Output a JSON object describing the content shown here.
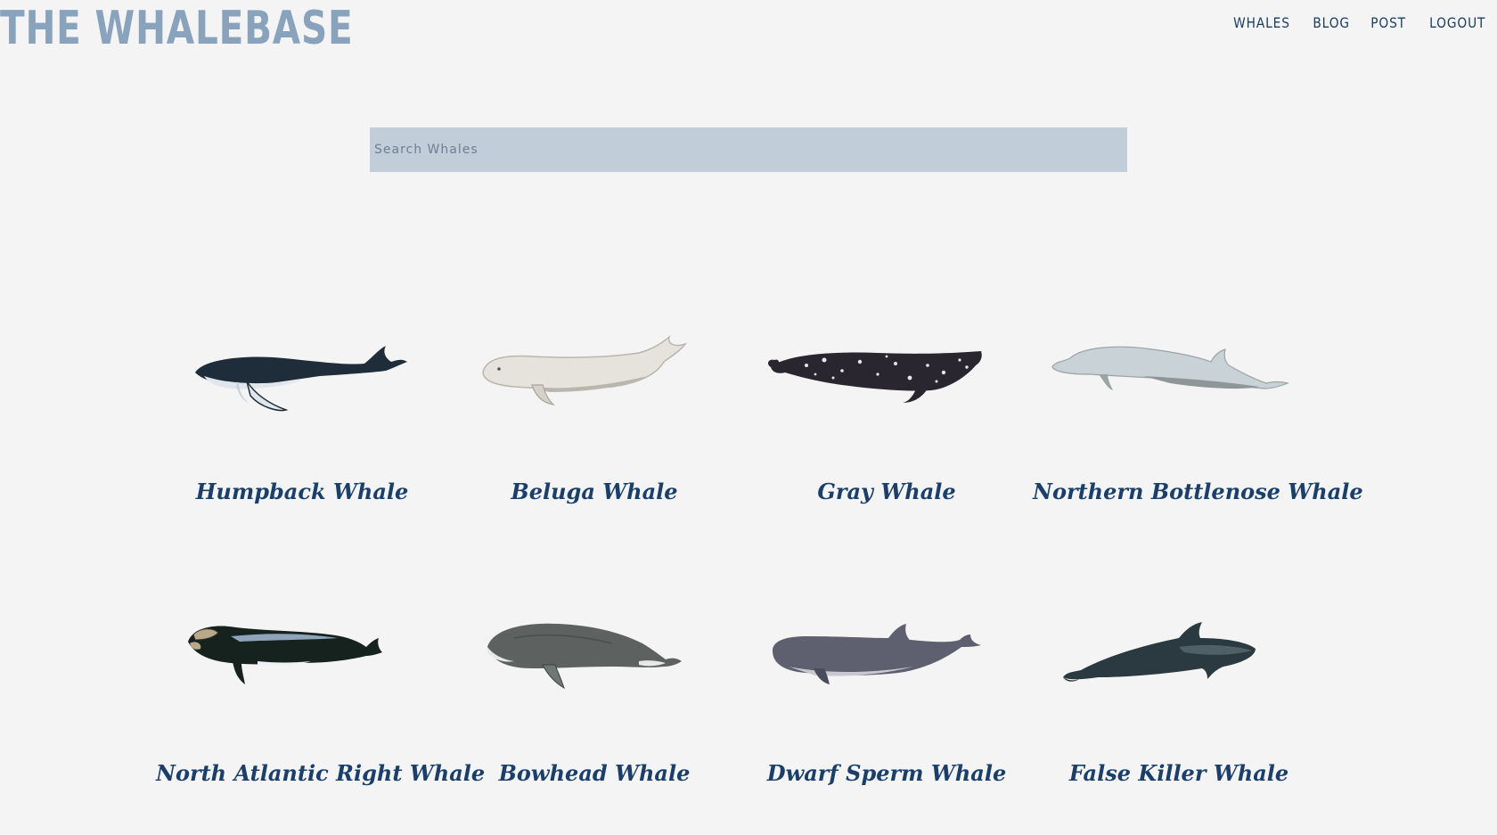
{
  "header": {
    "brand": "THE WHALEBASE",
    "nav": [
      "WHALES",
      "BLOG",
      "POST",
      "LOGOUT"
    ]
  },
  "search": {
    "placeholder": "Search Whales",
    "value": ""
  },
  "whales": [
    {
      "name": "Humpback Whale",
      "icon": "humpback-whale-icon"
    },
    {
      "name": "Beluga Whale",
      "icon": "beluga-whale-icon"
    },
    {
      "name": "Gray Whale",
      "icon": "gray-whale-icon"
    },
    {
      "name": "Northern Bottlenose Whale",
      "icon": "bottlenose-whale-icon"
    },
    {
      "name": "North Atlantic Right Whale",
      "icon": "right-whale-icon"
    },
    {
      "name": "Bowhead Whale",
      "icon": "bowhead-whale-icon"
    },
    {
      "name": "Dwarf Sperm Whale",
      "icon": "dwarf-sperm-whale-icon"
    },
    {
      "name": "False Killer Whale",
      "icon": "false-killer-whale-icon"
    }
  ],
  "colors": {
    "background": "#f4f4f4",
    "brand": "#8aa3bd",
    "nav": "#1b3d63",
    "search_bg": "#c1cdd9",
    "card_title": "#1b3f6b"
  }
}
